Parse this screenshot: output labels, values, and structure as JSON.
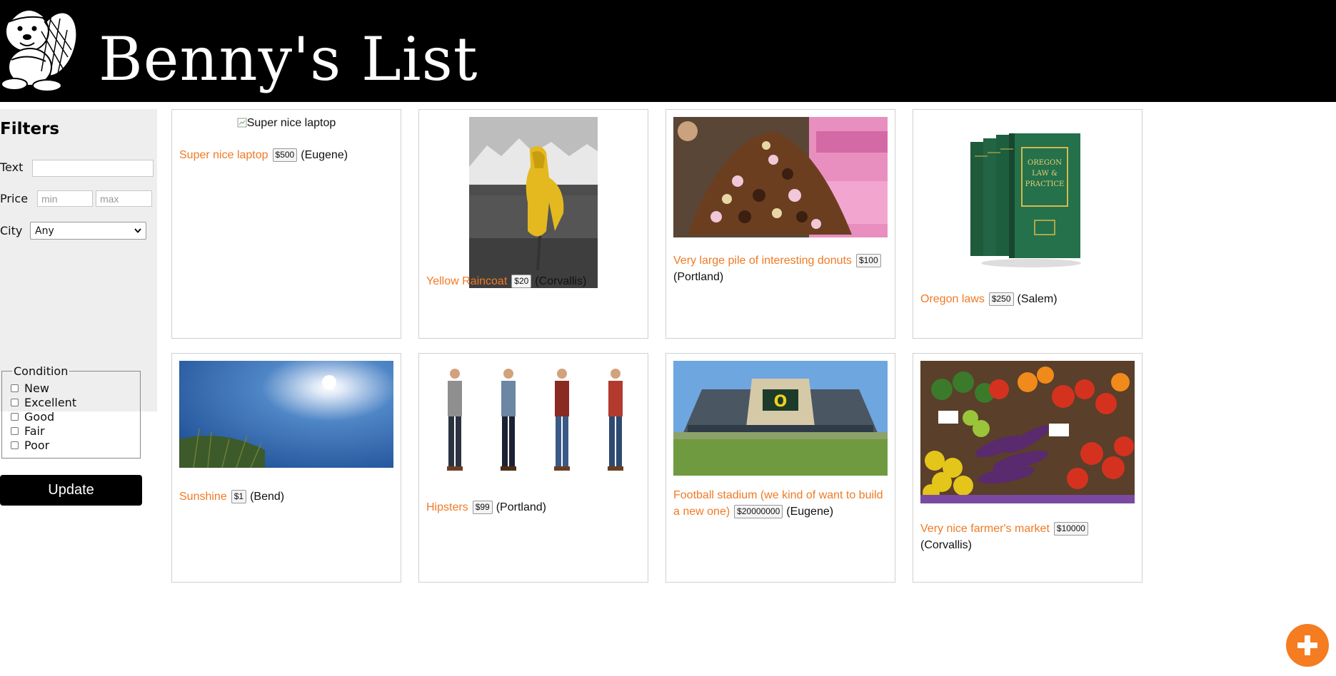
{
  "header": {
    "title": "Benny's List",
    "logo_icon": "beaver-mascot-icon"
  },
  "filters": {
    "heading": "Filters",
    "text_label": "Text",
    "text_value": "",
    "price_label": "Price",
    "price_min_placeholder": "min",
    "price_max_placeholder": "max",
    "city_label": "City",
    "city_selected": "Any",
    "condition_legend": "Condition",
    "conditions": [
      "New",
      "Excellent",
      "Good",
      "Fair",
      "Poor"
    ],
    "update_label": "Update"
  },
  "posts": [
    {
      "title": "Super nice laptop",
      "price": "$500",
      "city": "(Eugene)",
      "image_alt": "Super nice laptop"
    },
    {
      "title": "Yellow Raincoat",
      "price": "$20",
      "city": "(Corvallis)"
    },
    {
      "title": "Very large pile of interesting donuts",
      "price": "$100",
      "city": "(Portland)"
    },
    {
      "title": "Oregon laws",
      "price": "$250",
      "city": "(Salem)",
      "book_spine_text": "OREGON LAW & PRACTICE"
    },
    {
      "title": "Sunshine",
      "price": "$1",
      "city": "(Bend)"
    },
    {
      "title": "Hipsters",
      "price": "$99",
      "city": "(Portland)"
    },
    {
      "title": "Football stadium (we kind of want to build a new one)",
      "price": "$20000000",
      "city": "(Eugene)"
    },
    {
      "title": "Very nice farmer's market",
      "price": "$10000",
      "city": "(Corvallis)"
    }
  ],
  "add_button_icon": "plus-icon",
  "colors": {
    "accent": "#f07a25",
    "header_bg": "#000000",
    "fab": "#f57c20"
  }
}
